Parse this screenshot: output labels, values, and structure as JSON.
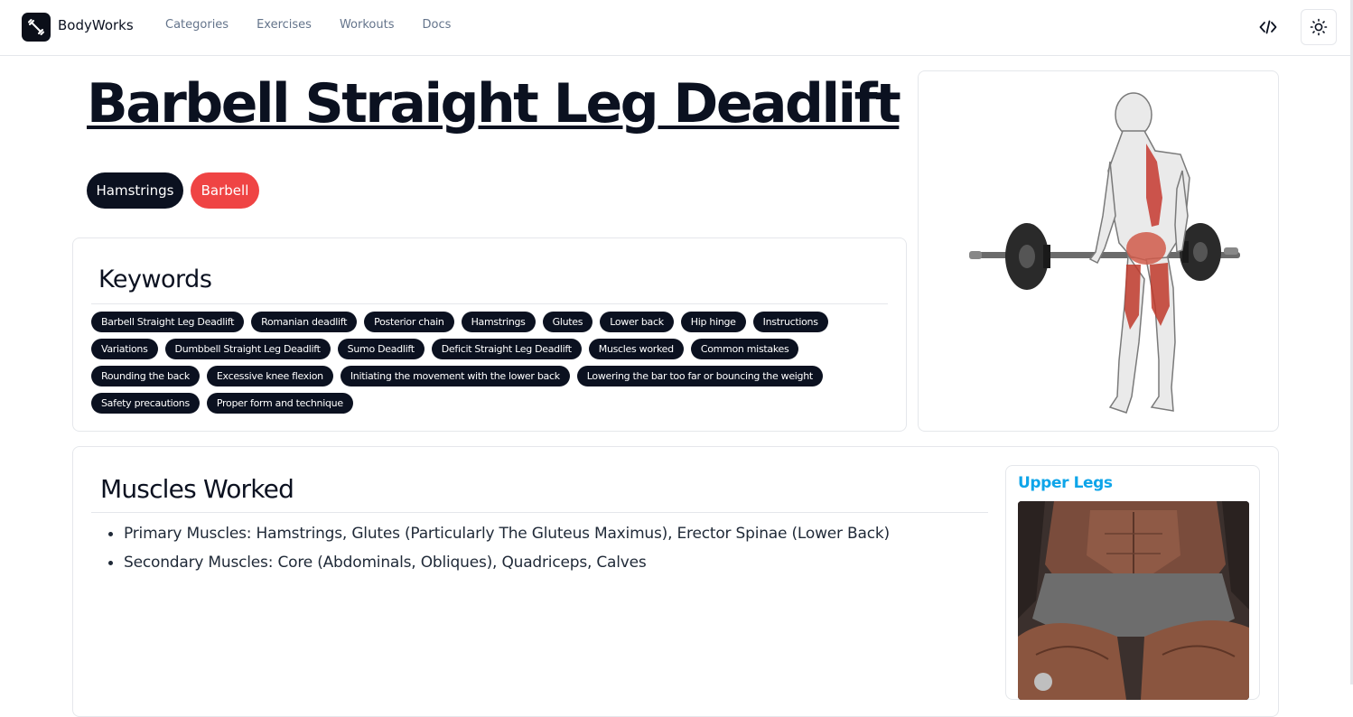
{
  "header": {
    "brand": "BodyWorks",
    "nav": [
      "Categories",
      "Exercises",
      "Workouts",
      "Docs"
    ]
  },
  "exercise": {
    "title": "Barbell Straight Leg Deadlift",
    "target": "Hamstrings",
    "equipment": "Barbell"
  },
  "keywords": {
    "heading": "Keywords",
    "tags": [
      "Barbell Straight Leg Deadlift",
      "Romanian deadlift",
      "Posterior chain",
      "Hamstrings",
      "Glutes",
      "Lower back",
      "Hip hinge",
      "Instructions",
      "Variations",
      "Dumbbell Straight Leg Deadlift",
      "Sumo Deadlift",
      "Deficit Straight Leg Deadlift",
      "Muscles worked",
      "Common mistakes",
      "Rounding the back",
      "Excessive knee flexion",
      "Initiating the movement with the lower back",
      "Lowering the bar too far or bouncing the weight",
      "Safety precautions",
      "Proper form and technique"
    ]
  },
  "muscles": {
    "heading": "Muscles Worked",
    "items": [
      "Primary Muscles: Hamstrings, Glutes (Particularly The Gluteus Maximus), Erector Spinae (Lower Back)",
      "Secondary Muscles: Core (Abdominals, Obliques), Quadriceps, Calves"
    ],
    "body_part": "Upper Legs"
  },
  "icons": {
    "logo": "dumbbell-icon",
    "code": "code-icon",
    "theme": "sun-icon"
  },
  "colors": {
    "dark": "#0b1120",
    "accent_red": "#ef4444",
    "link_blue": "#0ea5e9"
  }
}
